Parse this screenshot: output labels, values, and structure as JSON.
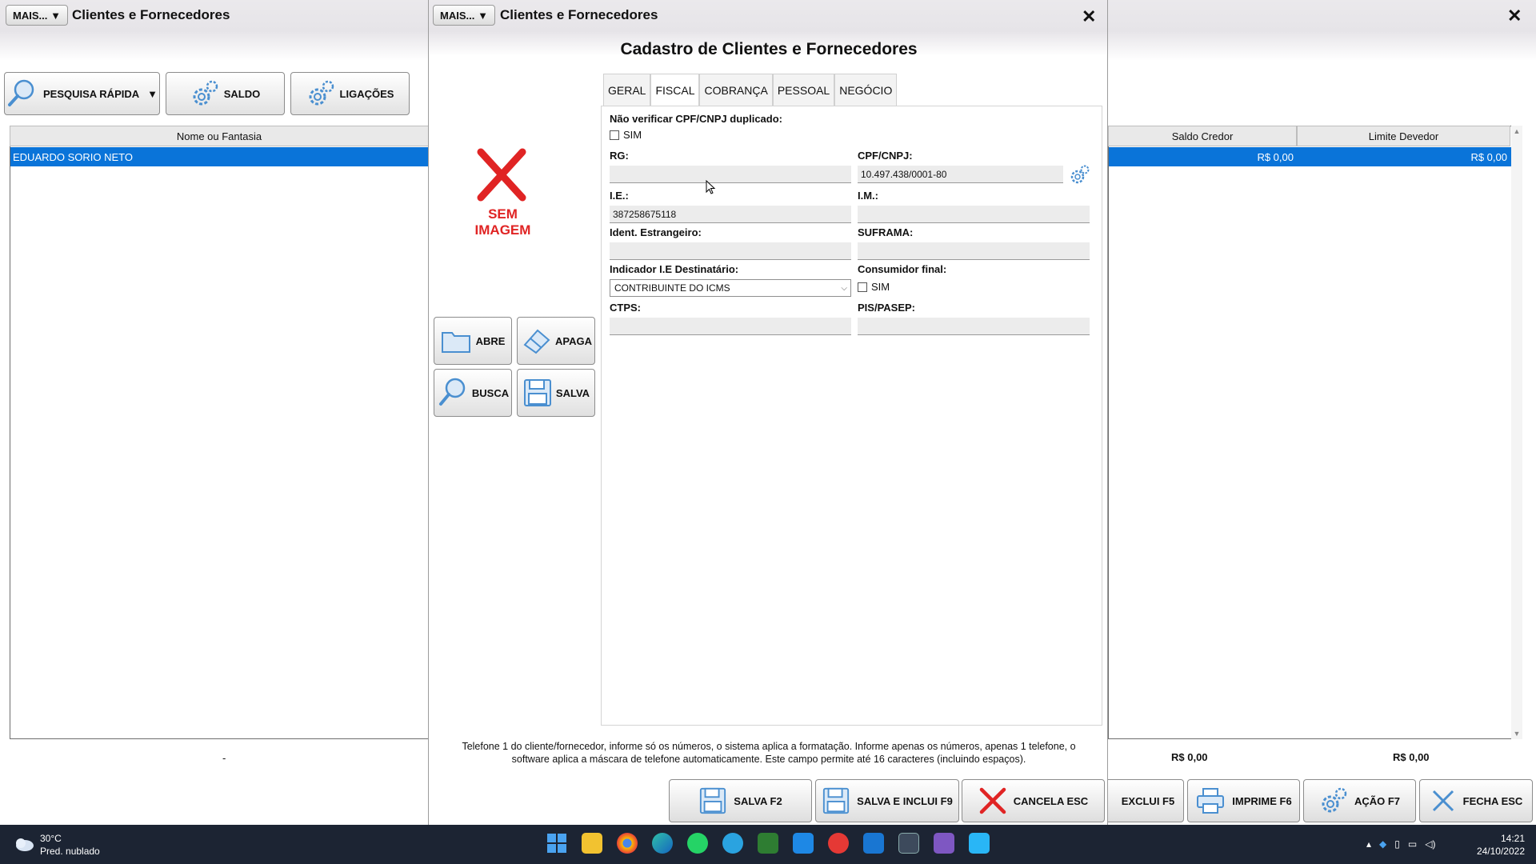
{
  "background_window": {
    "mais_label": "MAIS...",
    "title": "Clientes e Fornecedores",
    "toolbar": {
      "pesquisa_label": "PESQUISA RÁPIDA",
      "saldo_label": "SALDO",
      "ligacoes_label": "LIGAÇÕES"
    },
    "grid": {
      "left_header": "Nome ou Fantasia",
      "right_headers": [
        "Saldo Credor",
        "Limite Devedor"
      ],
      "rows": [
        {
          "nome": "EDUARDO SORIO NETO",
          "saldo_credor": "R$ 0,00",
          "limite_devedor": "R$ 0,00"
        }
      ],
      "left_footer": "-",
      "totals": [
        "R$ 0,00",
        "R$ 0,00"
      ]
    },
    "bottom_buttons": {
      "exclui": "EXCLUI F5",
      "imprime": "IMPRIME F6",
      "acao": "AÇÃO F7",
      "fecha": "FECHA ESC"
    }
  },
  "modal": {
    "mais_label": "MAIS...",
    "title": "Clientes e Fornecedores",
    "heading": "Cadastro de Clientes e Fornecedores",
    "image_placeholder": {
      "line1": "SEM",
      "line2": "IMAGEM"
    },
    "side_buttons": {
      "abre": "ABRE",
      "apaga": "APAGA",
      "busca": "BUSCA",
      "salva": "SALVA"
    },
    "tabs": [
      "GERAL",
      "FISCAL",
      "COBRANÇA",
      "PESSOAL",
      "NEGÓCIO"
    ],
    "active_tab": "FISCAL",
    "fiscal": {
      "nao_verificar_label": "Não verificar CPF/CNPJ duplicado:",
      "nao_verificar_cb": "SIM",
      "rg_label": "RG:",
      "rg_value": "",
      "cpf_label": "CPF/CNPJ:",
      "cpf_value": "10.497.438/0001-80",
      "ie_label": "I.E.:",
      "ie_value": "387258675118",
      "im_label": "I.M.:",
      "im_value": "",
      "ident_label": "Ident. Estrangeiro:",
      "suframa_label": "SUFRAMA:",
      "indicador_label": "Indicador I.E Destinatário:",
      "indicador_value": "CONTRIBUINTE DO ICMS",
      "consumidor_label": "Consumidor final:",
      "consumidor_cb": "SIM",
      "ctps_label": "CTPS:",
      "pis_label": "PIS/PASEP:"
    },
    "help_text_1": "Telefone 1 do cliente/fornecedor, informe só os números, o sistema aplica a formatação. Informe apenas os números, apenas 1 telefone, o",
    "help_text_2": "software aplica a máscara de telefone automaticamente. Este campo permite até 16 caracteres (incluindo espaços).",
    "bottom_buttons": {
      "salva": "SALVA F2",
      "salva_inclui": "SALVA E INCLUI F9",
      "cancela": "CANCELA ESC"
    }
  },
  "taskbar": {
    "weather_temp": "30°C",
    "weather_desc": "Pred. nublado",
    "time": "14:21",
    "date": "24/10/2022"
  },
  "colors": {
    "selection": "#0a74d9",
    "taskbar": "#1c2433",
    "cancel_red": "#e02424",
    "icon_blue": "#4a8fd0"
  }
}
